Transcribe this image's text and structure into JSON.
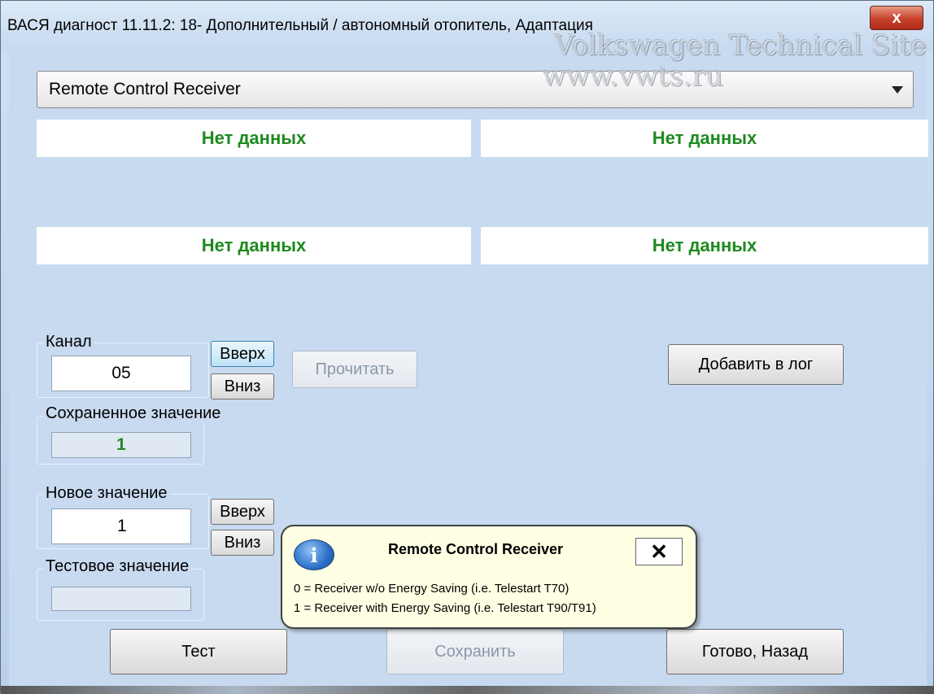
{
  "window": {
    "title": "ВАСЯ диагност 11.11.2: 18- Дополнительный / автономный отопитель, Адаптация",
    "close_glyph": "x"
  },
  "watermark": {
    "line1": "Volkswagen Technical Site",
    "line2": "www.vwts.ru"
  },
  "dropdown": {
    "selected": "Remote Control Receiver"
  },
  "measurements": {
    "cells": [
      "Нет данных",
      "Нет данных",
      "Нет данных",
      "Нет данных"
    ]
  },
  "channel": {
    "label": "Канал",
    "value": "05",
    "up_label": "Вверх",
    "down_label": "Вниз"
  },
  "read_button": "Прочитать",
  "log_button": "Добавить в лог",
  "saved_value": {
    "label": "Сохраненное значение",
    "value": "1"
  },
  "new_value": {
    "label": "Новое значение",
    "value": "1",
    "up_label": "Вверх",
    "down_label": "Вниз"
  },
  "test_value": {
    "label": "Тестовое значение",
    "value": ""
  },
  "buttons": {
    "test": "Тест",
    "save": "Сохранить",
    "done": "Готово, Назад"
  },
  "tooltip": {
    "icon": "info-icon",
    "icon_glyph": "i",
    "title": "Remote Control Receiver",
    "close_glyph": "✕",
    "line1": "0 = Receiver w/o Energy Saving (i.e. Telestart T70)",
    "line2": "1 = Receiver with Energy Saving (i.e. Telestart T90/T91)"
  },
  "colors": {
    "nodata_text": "#1e8a1e",
    "background": "#c8daf0",
    "tooltip_bg": "#ffffe4"
  }
}
